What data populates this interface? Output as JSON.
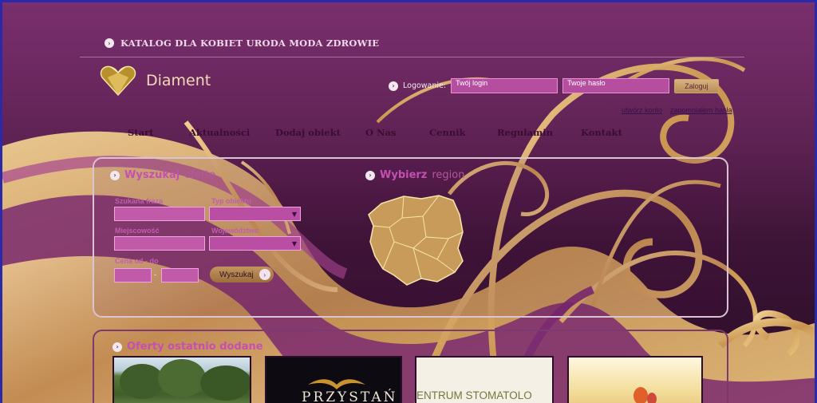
{
  "header": {
    "tagline": "KATALOG DLA KOBIET URODA MODA ZDROWIE",
    "logo_name": "Diament"
  },
  "login": {
    "label": "Logowanie:",
    "login_value": "Twój login",
    "password_value": "Twoje hasło",
    "submit_label": "Zaloguj",
    "register_link": "utwórz konto",
    "forgot_link": "zapomniałem hasła"
  },
  "nav": {
    "items": [
      {
        "label": "Start"
      },
      {
        "label": "Aktualności"
      },
      {
        "label": "Dodaj obiekt"
      },
      {
        "label": "O Nas"
      },
      {
        "label": "Cennik"
      },
      {
        "label": "Regulamin"
      },
      {
        "label": "Kontakt"
      }
    ]
  },
  "search": {
    "title_bold": "Wyszukaj",
    "title_rest": "ofertę",
    "phrase_label": "Szukana fraza",
    "type_label": "Typ obiektu",
    "city_label": "Miejscowość",
    "province_label": "Województwo",
    "price_label": "Cena od - do",
    "price_sep": "-",
    "submit_label": "Wyszukaj"
  },
  "region": {
    "title_bold": "Wybierz",
    "title_rest": "region"
  },
  "offers": {
    "title": "Oferty ostatnio dodane",
    "thumbs": [
      {
        "caption": ""
      },
      {
        "caption": "PRZYSTAŃ"
      },
      {
        "caption": "ENTRUM STOMATOLO"
      },
      {
        "caption": ""
      }
    ]
  },
  "colors": {
    "background": "#5e2253",
    "gold": "#d8aa6a",
    "accent_pink": "#c64fb3",
    "frame": "#2a2aa8"
  },
  "icons": {
    "bullet": "arrow-circle-icon",
    "logo": "heart-diamond-icon",
    "select_arrow": "triangle-down-icon",
    "map": "poland-map"
  }
}
